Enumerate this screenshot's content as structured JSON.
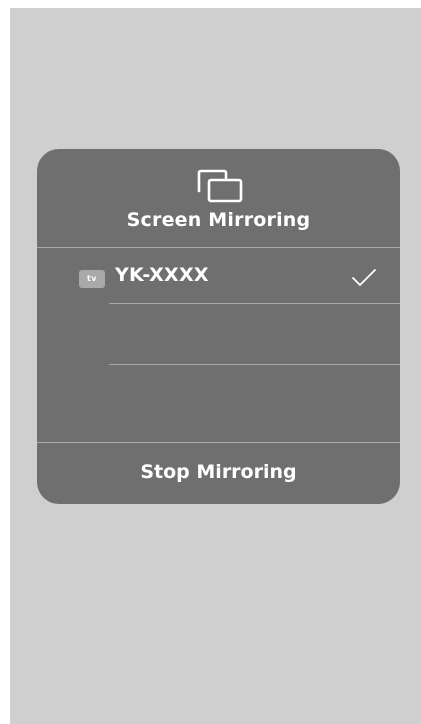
{
  "screen_mirroring": {
    "title": "Screen Mirroring",
    "icon": "screen-mirroring-icon",
    "devices": [
      {
        "badge": "tv",
        "name": "YK-XXXX",
        "selected": true
      }
    ],
    "stop_label": "Stop Mirroring"
  },
  "colors": {
    "background": "#cfcfcf",
    "panel": "#6f6f6f",
    "divider": "#a9a9a9",
    "text": "#ffffff"
  }
}
